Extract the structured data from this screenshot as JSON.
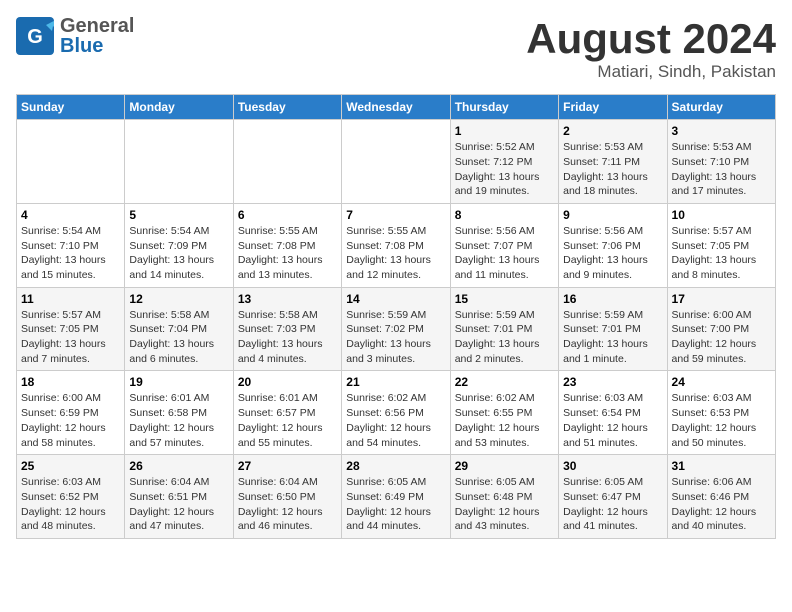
{
  "header": {
    "logo_general": "General",
    "logo_blue": "Blue",
    "month": "August 2024",
    "location": "Matiari, Sindh, Pakistan"
  },
  "weekdays": [
    "Sunday",
    "Monday",
    "Tuesday",
    "Wednesday",
    "Thursday",
    "Friday",
    "Saturday"
  ],
  "weeks": [
    [
      {
        "day": "",
        "info": ""
      },
      {
        "day": "",
        "info": ""
      },
      {
        "day": "",
        "info": ""
      },
      {
        "day": "",
        "info": ""
      },
      {
        "day": "1",
        "info": "Sunrise: 5:52 AM\nSunset: 7:12 PM\nDaylight: 13 hours and 19 minutes."
      },
      {
        "day": "2",
        "info": "Sunrise: 5:53 AM\nSunset: 7:11 PM\nDaylight: 13 hours and 18 minutes."
      },
      {
        "day": "3",
        "info": "Sunrise: 5:53 AM\nSunset: 7:10 PM\nDaylight: 13 hours and 17 minutes."
      }
    ],
    [
      {
        "day": "4",
        "info": "Sunrise: 5:54 AM\nSunset: 7:10 PM\nDaylight: 13 hours and 15 minutes."
      },
      {
        "day": "5",
        "info": "Sunrise: 5:54 AM\nSunset: 7:09 PM\nDaylight: 13 hours and 14 minutes."
      },
      {
        "day": "6",
        "info": "Sunrise: 5:55 AM\nSunset: 7:08 PM\nDaylight: 13 hours and 13 minutes."
      },
      {
        "day": "7",
        "info": "Sunrise: 5:55 AM\nSunset: 7:08 PM\nDaylight: 13 hours and 12 minutes."
      },
      {
        "day": "8",
        "info": "Sunrise: 5:56 AM\nSunset: 7:07 PM\nDaylight: 13 hours and 11 minutes."
      },
      {
        "day": "9",
        "info": "Sunrise: 5:56 AM\nSunset: 7:06 PM\nDaylight: 13 hours and 9 minutes."
      },
      {
        "day": "10",
        "info": "Sunrise: 5:57 AM\nSunset: 7:05 PM\nDaylight: 13 hours and 8 minutes."
      }
    ],
    [
      {
        "day": "11",
        "info": "Sunrise: 5:57 AM\nSunset: 7:05 PM\nDaylight: 13 hours and 7 minutes."
      },
      {
        "day": "12",
        "info": "Sunrise: 5:58 AM\nSunset: 7:04 PM\nDaylight: 13 hours and 6 minutes."
      },
      {
        "day": "13",
        "info": "Sunrise: 5:58 AM\nSunset: 7:03 PM\nDaylight: 13 hours and 4 minutes."
      },
      {
        "day": "14",
        "info": "Sunrise: 5:59 AM\nSunset: 7:02 PM\nDaylight: 13 hours and 3 minutes."
      },
      {
        "day": "15",
        "info": "Sunrise: 5:59 AM\nSunset: 7:01 PM\nDaylight: 13 hours and 2 minutes."
      },
      {
        "day": "16",
        "info": "Sunrise: 5:59 AM\nSunset: 7:01 PM\nDaylight: 13 hours and 1 minute."
      },
      {
        "day": "17",
        "info": "Sunrise: 6:00 AM\nSunset: 7:00 PM\nDaylight: 12 hours and 59 minutes."
      }
    ],
    [
      {
        "day": "18",
        "info": "Sunrise: 6:00 AM\nSunset: 6:59 PM\nDaylight: 12 hours and 58 minutes."
      },
      {
        "day": "19",
        "info": "Sunrise: 6:01 AM\nSunset: 6:58 PM\nDaylight: 12 hours and 57 minutes."
      },
      {
        "day": "20",
        "info": "Sunrise: 6:01 AM\nSunset: 6:57 PM\nDaylight: 12 hours and 55 minutes."
      },
      {
        "day": "21",
        "info": "Sunrise: 6:02 AM\nSunset: 6:56 PM\nDaylight: 12 hours and 54 minutes."
      },
      {
        "day": "22",
        "info": "Sunrise: 6:02 AM\nSunset: 6:55 PM\nDaylight: 12 hours and 53 minutes."
      },
      {
        "day": "23",
        "info": "Sunrise: 6:03 AM\nSunset: 6:54 PM\nDaylight: 12 hours and 51 minutes."
      },
      {
        "day": "24",
        "info": "Sunrise: 6:03 AM\nSunset: 6:53 PM\nDaylight: 12 hours and 50 minutes."
      }
    ],
    [
      {
        "day": "25",
        "info": "Sunrise: 6:03 AM\nSunset: 6:52 PM\nDaylight: 12 hours and 48 minutes."
      },
      {
        "day": "26",
        "info": "Sunrise: 6:04 AM\nSunset: 6:51 PM\nDaylight: 12 hours and 47 minutes."
      },
      {
        "day": "27",
        "info": "Sunrise: 6:04 AM\nSunset: 6:50 PM\nDaylight: 12 hours and 46 minutes."
      },
      {
        "day": "28",
        "info": "Sunrise: 6:05 AM\nSunset: 6:49 PM\nDaylight: 12 hours and 44 minutes."
      },
      {
        "day": "29",
        "info": "Sunrise: 6:05 AM\nSunset: 6:48 PM\nDaylight: 12 hours and 43 minutes."
      },
      {
        "day": "30",
        "info": "Sunrise: 6:05 AM\nSunset: 6:47 PM\nDaylight: 12 hours and 41 minutes."
      },
      {
        "day": "31",
        "info": "Sunrise: 6:06 AM\nSunset: 6:46 PM\nDaylight: 12 hours and 40 minutes."
      }
    ]
  ]
}
